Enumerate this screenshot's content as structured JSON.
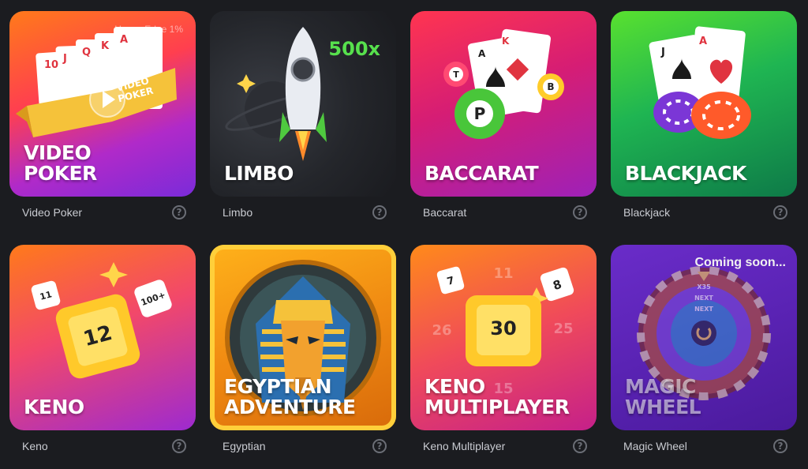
{
  "games": [
    {
      "key": "video-poker",
      "tile_title": "VIDEO\nPOKER",
      "caption": "Video Poker",
      "overlay": "House Edge 1%",
      "banner": "VIDEO\nPOKER",
      "cards": [
        "10",
        "J",
        "Q",
        "K",
        "A"
      ]
    },
    {
      "key": "limbo",
      "tile_title": "LIMBO",
      "caption": "Limbo",
      "multiplier": "500x"
    },
    {
      "key": "baccarat",
      "tile_title": "BACCARAT",
      "caption": "Baccarat",
      "balls": [
        "T",
        "B",
        "P"
      ],
      "cards": [
        "A",
        "K"
      ]
    },
    {
      "key": "blackjack",
      "tile_title": "BLACKJACK",
      "caption": "Blackjack",
      "cards": [
        "J",
        "A"
      ]
    },
    {
      "key": "keno",
      "tile_title": "KENO",
      "caption": "Keno",
      "dice": [
        "11",
        "12",
        "100+"
      ]
    },
    {
      "key": "egyptian",
      "tile_title": "EGYPTIAN\nADVENTURE",
      "caption": "Egyptian"
    },
    {
      "key": "keno-multiplayer",
      "tile_title": "KENO\nMULTIPLAYER",
      "caption": "Keno Multiplayer",
      "numbers": [
        "11",
        "26",
        "25",
        "15",
        "7",
        "8",
        "30"
      ]
    },
    {
      "key": "magic-wheel",
      "tile_title": "MAGIC\nWHEEL",
      "caption": "Magic Wheel",
      "overlay": "Coming soon...",
      "wheel_labels": [
        "X35",
        "NEXT",
        "NEXT"
      ]
    }
  ],
  "help_symbol": "?",
  "colors": {
    "background": "#1b1c20",
    "limbo_green": "#57e04d"
  }
}
